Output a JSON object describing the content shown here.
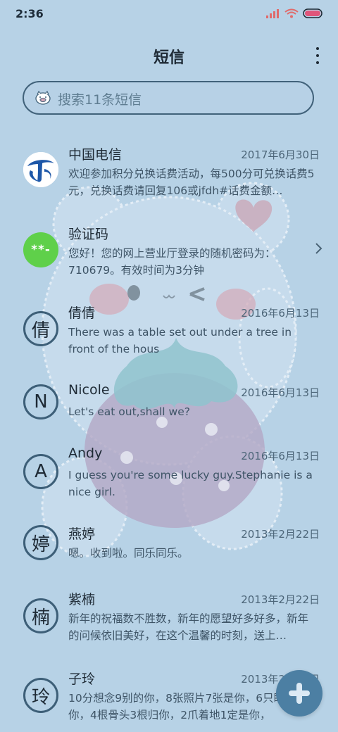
{
  "status_bar": {
    "time": "2:36"
  },
  "header": {
    "title": "短信",
    "more_icon": "more-vertical-icon"
  },
  "search": {
    "placeholder": "搜索11条短信",
    "icon": "pig-face-icon"
  },
  "messages": [
    {
      "sender": "中国电信",
      "date": "2017年6月30日",
      "snippet": "欢迎参加积分兑换话费活动，每500分可兑换话费5元，兑换话费请回复106或jfdh#话费金额…",
      "avatar_type": "telecom-logo"
    },
    {
      "sender": "验证码",
      "date": "",
      "snippet": "您好！您的网上营业厅登录的随机密码为：710679。有效时间为3分钟",
      "avatar_text": "**-",
      "avatar_type": "code"
    },
    {
      "sender": "倩倩",
      "date": "2016年6月13日",
      "snippet": "There was a table set out under a tree in front of the hous",
      "avatar_text": "倩"
    },
    {
      "sender": "Nicole",
      "date": "2016年6月13日",
      "snippet": "Let's eat out,shall we?",
      "avatar_text": "N"
    },
    {
      "sender": "Andy",
      "date": "2016年6月13日",
      "snippet": "I guess you're some lucky guy.Stephanie is a nice girl.",
      "avatar_text": "A"
    },
    {
      "sender": "燕婷",
      "date": "2013年2月22日",
      "snippet": "嗯。收到啦。同乐同乐。",
      "avatar_text": "婷"
    },
    {
      "sender": "紫楠",
      "date": "2013年2月22日",
      "snippet": "新年的祝福数不胜数，新年的愿望好多好多，新年的问候依旧美好，在这个温馨的时刻，送上…",
      "avatar_text": "楠"
    },
    {
      "sender": "子玲",
      "date": "2013年2月22日",
      "snippet": "10分想念9别的你，8张照片7张是你，6只眼睛只像你，4根骨头3根归你，2爪着地1定是你，",
      "avatar_text": "玲"
    }
  ],
  "fab": {
    "icon": "plus-icon"
  },
  "colors": {
    "background": "#b7d2e6",
    "accent": "#4c7fa3",
    "border": "#3d5f78",
    "code_avatar": "#5fd04a",
    "battery": "#e0557a"
  }
}
